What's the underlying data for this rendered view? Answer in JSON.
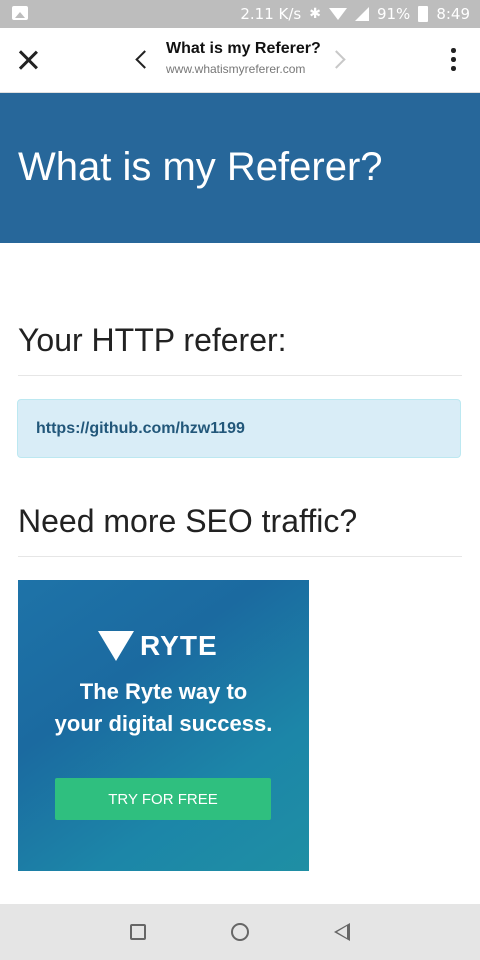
{
  "status_bar": {
    "speed": "2.11 K/s",
    "battery": "91%",
    "time": "8:49",
    "icons": [
      "gallery-icon",
      "bluetooth-icon",
      "wifi-icon",
      "signal-icon",
      "battery-icon"
    ]
  },
  "toolbar": {
    "title": "What is my Referer?",
    "url": "www.whatismyreferer.com",
    "icons": [
      "close-icon",
      "back-icon",
      "forward-icon",
      "more-vert-icon"
    ]
  },
  "hero": {
    "heading": "What is my Referer?",
    "background_color": "#27679a"
  },
  "referer_section": {
    "title": "Your HTTP referer:",
    "value": "https://github.com/hzw1199"
  },
  "seo_section": {
    "title": "Need more SEO traffic?"
  },
  "ad": {
    "brand": "RYTE",
    "tagline_line1": "The Ryte way to",
    "tagline_line2": "your digital success.",
    "cta": "TRY FOR FREE",
    "cta_color": "#2fbf7f"
  },
  "nav_bar": {
    "icons": [
      "recents-icon",
      "home-icon",
      "back-icon"
    ]
  }
}
